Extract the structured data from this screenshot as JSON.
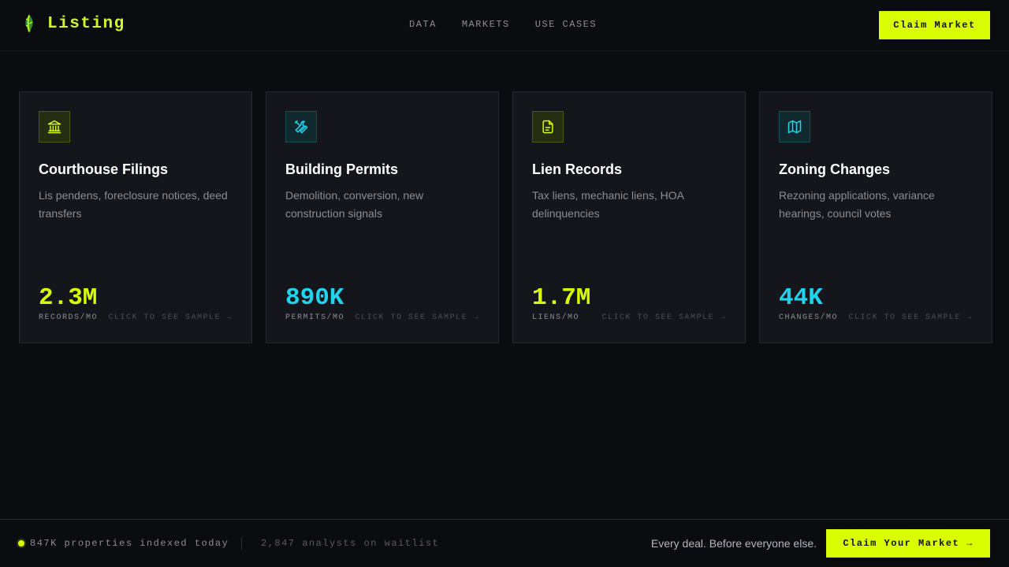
{
  "header": {
    "brand": "Listing",
    "nav": [
      "DATA",
      "MARKETS",
      "USE CASES"
    ],
    "cta_label": "Claim Market"
  },
  "cards": [
    {
      "icon": "courthouse-icon",
      "accent": "lime",
      "title": "Courthouse Filings",
      "description": "Lis pendens, foreclosure notices, deed transfers",
      "stat": "2.3M",
      "unit": "RECORDS/MO",
      "sample": "CLICK TO SEE SAMPLE →"
    },
    {
      "icon": "tools-icon",
      "accent": "cyan",
      "title": "Building Permits",
      "description": "Demolition, conversion, new construction signals",
      "stat": "890K",
      "unit": "PERMITS/MO",
      "sample": "CLICK TO SEE SAMPLE →"
    },
    {
      "icon": "document-icon",
      "accent": "lime",
      "title": "Lien Records",
      "description": "Tax liens, mechanic liens, HOA delinquencies",
      "stat": "1.7M",
      "unit": "LIENS/MO",
      "sample": "CLICK TO SEE SAMPLE →"
    },
    {
      "icon": "map-icon",
      "accent": "cyan",
      "title": "Zoning Changes",
      "description": "Rezoning applications, variance hearings, council votes",
      "stat": "44K",
      "unit": "CHANGES/MO",
      "sample": "CLICK TO SEE SAMPLE →"
    }
  ],
  "footer": {
    "status": "847K properties indexed today",
    "waitlist": "2,847 analysts on waitlist",
    "tagline": "Every deal. Before everyone else.",
    "cta_label": "Claim Your Market →"
  },
  "colors": {
    "background": "#0b0c10",
    "lime": "#d9ff00",
    "cyan": "#22d3ee",
    "card": "#14161c"
  }
}
